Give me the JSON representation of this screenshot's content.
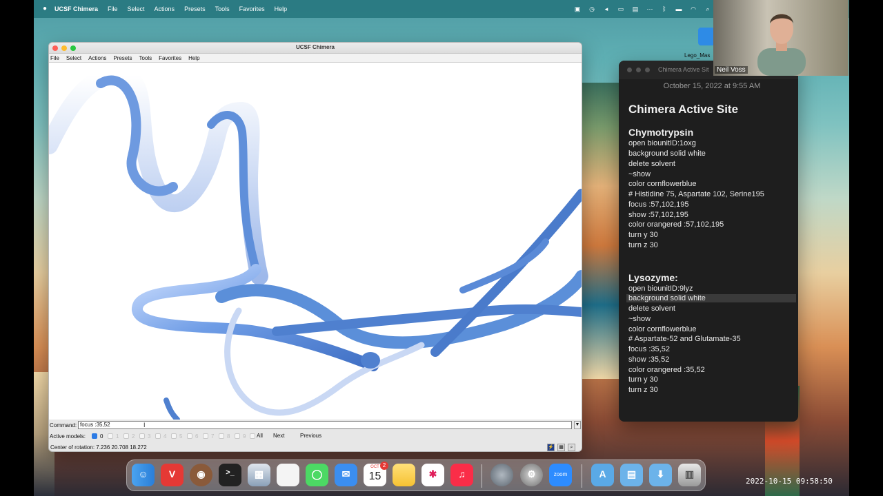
{
  "menubar": {
    "app": "UCSF Chimera",
    "items": [
      "File",
      "Select",
      "Actions",
      "Presets",
      "Tools",
      "Favorites",
      "Help"
    ]
  },
  "desktop_icon": {
    "label": "Lego_Mas"
  },
  "chimera": {
    "title": "UCSF Chimera",
    "menu": [
      "File",
      "Select",
      "Actions",
      "Presets",
      "Tools",
      "Favorites",
      "Help"
    ],
    "command_label": "Command:",
    "command_value": "focus :35,52",
    "active_models_label": "Active models:",
    "models": [
      "0",
      "1",
      "2",
      "3",
      "4",
      "5",
      "6",
      "7",
      "8",
      "9"
    ],
    "all_label": "All",
    "next_label": "Next",
    "previous_label": "Previous",
    "status": "Center of rotation: 7.236 20.708 18.272",
    "ribbon_color": "#5b8fd9"
  },
  "notes": {
    "window_title": "Chimera Active Sit",
    "date": "October 15, 2022 at 9:55 AM",
    "title": "Chimera Active Site",
    "section1": {
      "heading": "Chymotrypsin",
      "lines": [
        "open biounitID:1oxg",
        "background solid white",
        "delete solvent",
        "~show",
        "color cornflowerblue",
        "# Histidine 75, Aspartate 102, Serine195",
        "focus :57,102,195",
        "show :57,102,195",
        "color orangered :57,102,195",
        "turn y 30",
        "turn z 30"
      ]
    },
    "section2": {
      "heading": "Lysozyme:",
      "lines": [
        "open biounitID:9lyz",
        "background solid white",
        "delete solvent",
        "~show",
        "color cornflowerblue",
        "# Aspartate-52 and Glutamate-35",
        "focus :35,52",
        "show :35,52",
        "color orangered :35,52",
        "turn y 30",
        "turn z 30"
      ]
    }
  },
  "webcam": {
    "name": "Neil Voss"
  },
  "dock": {
    "calendar_month": "OCT",
    "calendar_day": "15",
    "calendar_badge": "2",
    "zoom_label": "zoom"
  },
  "timestamp": "2022-10-15  09:58:50"
}
